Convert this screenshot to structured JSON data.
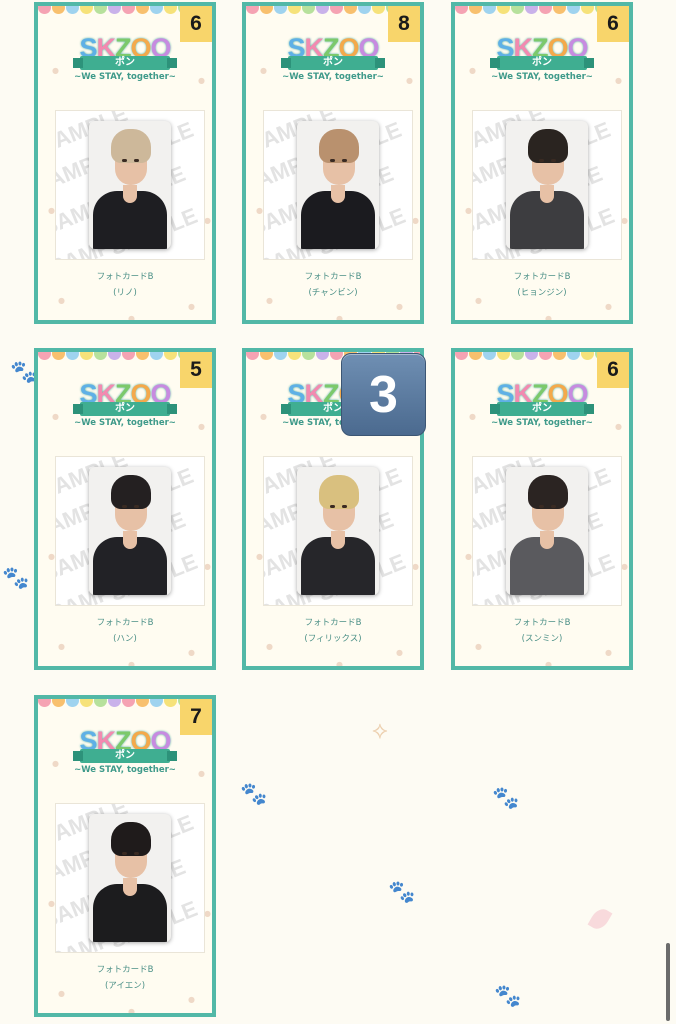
{
  "logo": {
    "brand": "SKZOO",
    "sub": "ポン",
    "tagline": "~We STAY, together~"
  },
  "sample_text": "SAMPLE",
  "colors": {
    "border": "#52b8a7",
    "badge": "#f8d56b",
    "accent": "#3fae91"
  },
  "dot_colors": [
    "#f5a3b3",
    "#f8c06e",
    "#9fd3ef",
    "#f6e27a",
    "#b7e19c",
    "#c9b2ea",
    "#f5a3b3",
    "#f8c06e",
    "#9fd3ef",
    "#f6e27a",
    "#b7e19c",
    "#c9b2ea",
    "#f5a3b3"
  ],
  "cards": [
    {
      "count": "6",
      "label": "フォトカードB",
      "name": "(リノ)",
      "hair": "#cdb89a",
      "outfit": "#1e1e22"
    },
    {
      "count": "8",
      "label": "フォトカードB",
      "name": "(チャンビン)",
      "hair": "#b9916e",
      "outfit": "#1b1b1f"
    },
    {
      "count": "6",
      "label": "フォトカードB",
      "name": "(ヒョンジン)",
      "hair": "#2a2420",
      "outfit": "#3d3d40"
    },
    {
      "count": "5",
      "label": "フォトカードB",
      "name": "(ハン)",
      "hair": "#242021",
      "outfit": "#222226"
    },
    {
      "count": "",
      "label": "フォトカードB",
      "name": "(フィリックス)",
      "hair": "#d9c07f",
      "outfit": "#26262a"
    },
    {
      "count": "6",
      "label": "フォトカードB",
      "name": "(スンミン)",
      "hair": "#2b2422",
      "outfit": "#5a5a5e"
    },
    {
      "count": "7",
      "label": "フォトカードB",
      "name": "(アイエン)",
      "hair": "#1f1b1b",
      "outfit": "#1c1c1e"
    }
  ],
  "overlay_badge": "3"
}
